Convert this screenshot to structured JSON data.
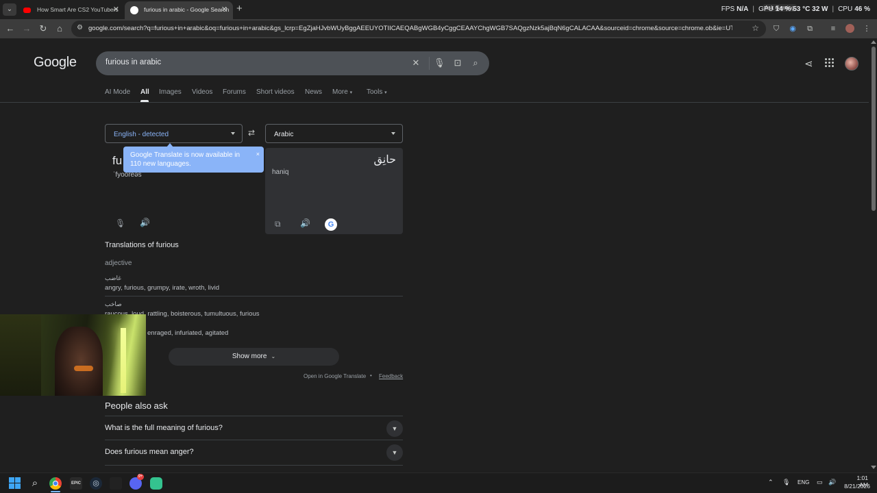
{
  "browser": {
    "tabs": [
      {
        "title": "How Smart Are CS2 YouTubers",
        "active": false
      },
      {
        "title": "furious in arabic - Google Search",
        "active": true
      }
    ],
    "url": "google.com/search?q=furious+in+arabic&oq=furious+in+arabic&gs_lcrp=EgZjaHJvbWUyBggAEEUYOTIICAEQABgWGB4yCggCEAAYChgWGB7SAQgzNzk5ajBqN6gCALACAA&sourceid=chrome&source=chrome.ob&ie=UTF-8",
    "overlay": {
      "fps_label": "FPS",
      "fps_value": "N/A",
      "gpu_label": "GPU",
      "gpu_value": "14 % 53 °C 32 W",
      "cpu_label": "CPU",
      "cpu_value": "46 %",
      "ask_gaming": "Ask Gaming"
    }
  },
  "google": {
    "logo": "Google",
    "query": "furious in arabic",
    "tabs": [
      "AI Mode",
      "All",
      "Images",
      "Videos",
      "Forums",
      "Short videos",
      "News",
      "More",
      "Tools"
    ],
    "active_tab": "All"
  },
  "translate": {
    "source_lang": "English - detected",
    "target_lang": "Arabic",
    "source_word": "fu",
    "source_phonetic": "ˈfyoorēəs",
    "tooltip": "Google Translate is now available in 110 new languages.",
    "tooltip_close": "×",
    "target_word": "حانِق",
    "target_translit": "haniq",
    "heading": "Translations of furious",
    "pos": "adjective",
    "entries": [
      {
        "ar": "غاضب",
        "en": "angry, furious, grumpy, irate, wroth, livid"
      },
      {
        "ar": "صاخب",
        "en": "raucous, loud, rattling, boisterous, tumultuous, furious"
      },
      {
        "ar": "",
        "en": "enraged, infuriated, agitated"
      }
    ],
    "show_more": "Show more",
    "open_in": "Open in Google Translate",
    "dot": "•",
    "feedback": "Feedback"
  },
  "paa": {
    "heading": "People also ask",
    "questions": [
      "What is the full meaning of furious?",
      "Does furious mean anger?"
    ]
  },
  "taskbar": {
    "lang": "ENG",
    "time": "1:01 AM",
    "date": "8/21/2026",
    "discord_badge": "9+"
  }
}
